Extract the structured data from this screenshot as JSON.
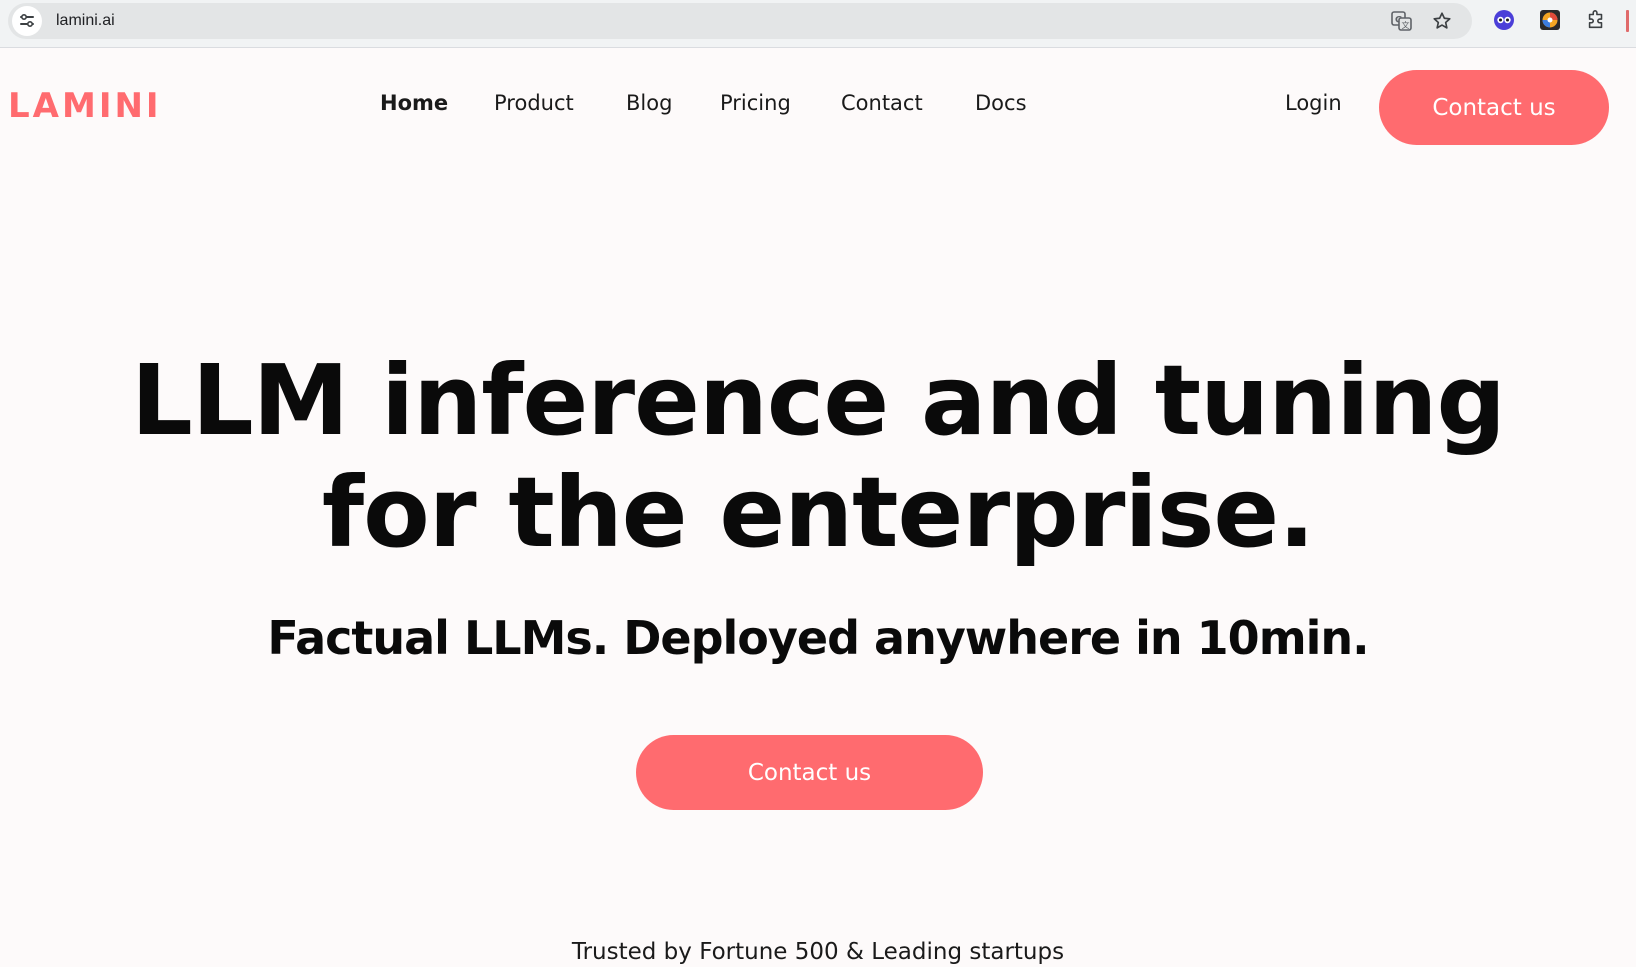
{
  "browser": {
    "url": "lamini.ai",
    "icons": [
      "site-info-icon",
      "translate-icon",
      "bookmark-star-icon",
      "extension-owl-icon",
      "extension-colorful-icon",
      "extensions-puzzle-icon"
    ]
  },
  "site": {
    "logo": "LAMINI",
    "brand_color": "#ff6b6f",
    "nav": [
      {
        "label": "Home",
        "active": true
      },
      {
        "label": "Product"
      },
      {
        "label": "Blog"
      },
      {
        "label": "Pricing"
      },
      {
        "label": "Contact"
      },
      {
        "label": "Docs"
      }
    ],
    "login": "Login",
    "header_cta": "Contact us"
  },
  "hero": {
    "title_line1": "LLM inference and tuning",
    "title_line2": "for the enterprise.",
    "subtitle": "Factual LLMs. Deployed anywhere in 10min.",
    "cta": "Contact us",
    "trusted": "Trusted by Fortune 500 & Leading startups"
  }
}
